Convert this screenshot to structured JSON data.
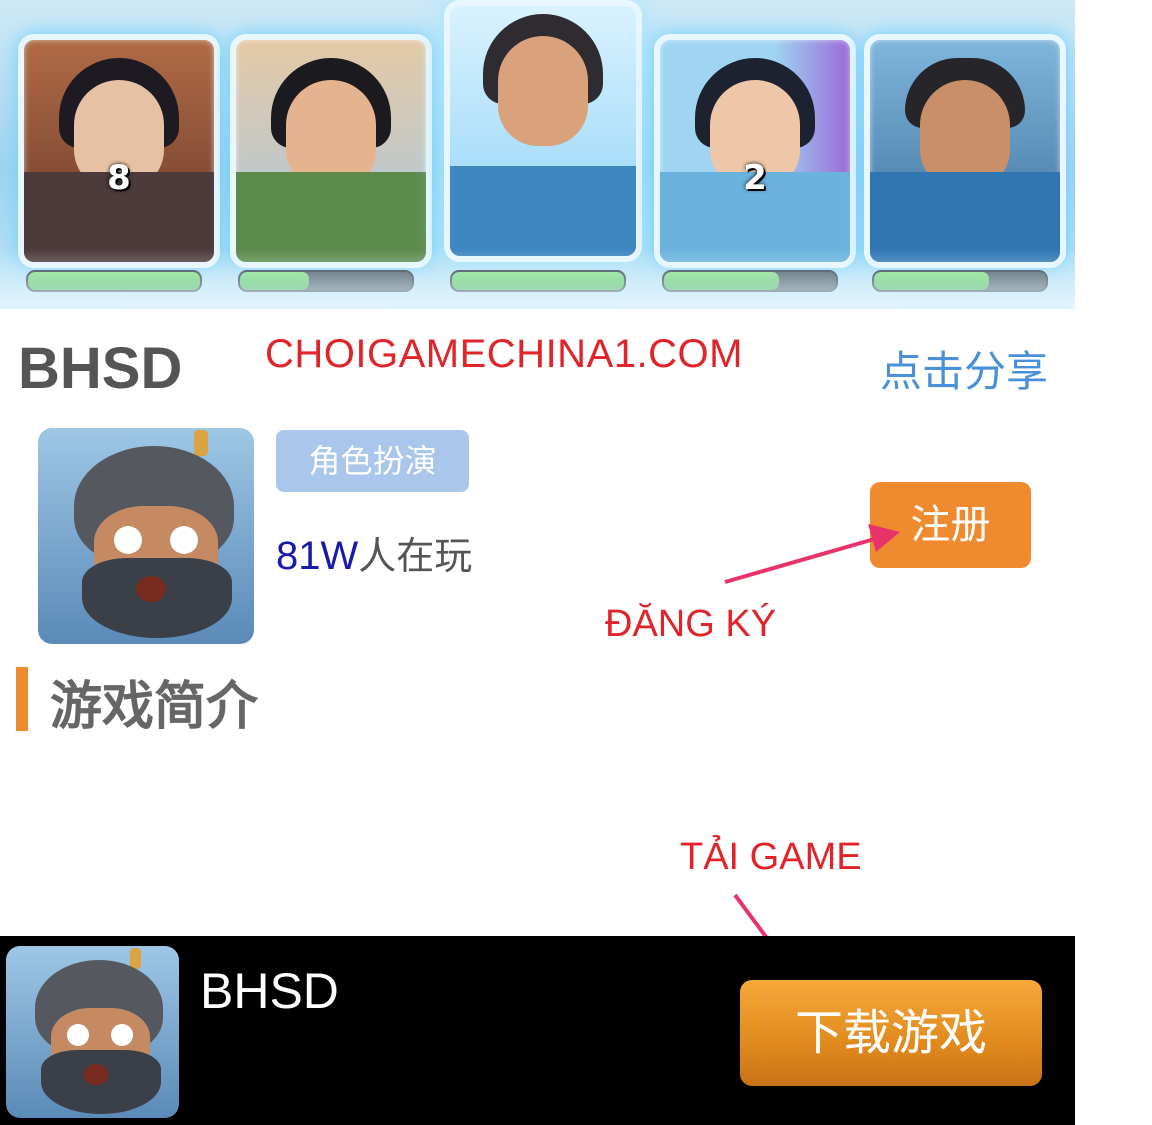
{
  "banner": {
    "cards": [
      {
        "number": "8",
        "hp_fraction": 1.0
      },
      {
        "number": "",
        "hp_fraction": 0.4
      },
      {
        "number": "",
        "hp_fraction": 1.0
      },
      {
        "number": "2",
        "hp_fraction": 0.67
      },
      {
        "number": "",
        "hp_fraction": 0.67
      }
    ]
  },
  "header": {
    "title": "BHSD",
    "watermark": "CHOIGAMECHINA1.COM",
    "share_label": "点击分享"
  },
  "game": {
    "genre_tag": "角色扮演",
    "player_count": "81W",
    "player_suffix": "人在玩",
    "register_label": "注册"
  },
  "annotations": {
    "register_note": "ĐĂNG KÝ",
    "download_note": "TẢI GAME",
    "arrow_color": "#e8336a"
  },
  "section": {
    "intro_title": "游戏简介"
  },
  "bottom_bar": {
    "name": "BHSD",
    "download_label": "下载游戏"
  },
  "colors": {
    "accent_orange": "#f08a2e",
    "share_blue": "#4a90d9",
    "watermark_red": "#e0242a",
    "tag_blue": "#aac6ea"
  }
}
